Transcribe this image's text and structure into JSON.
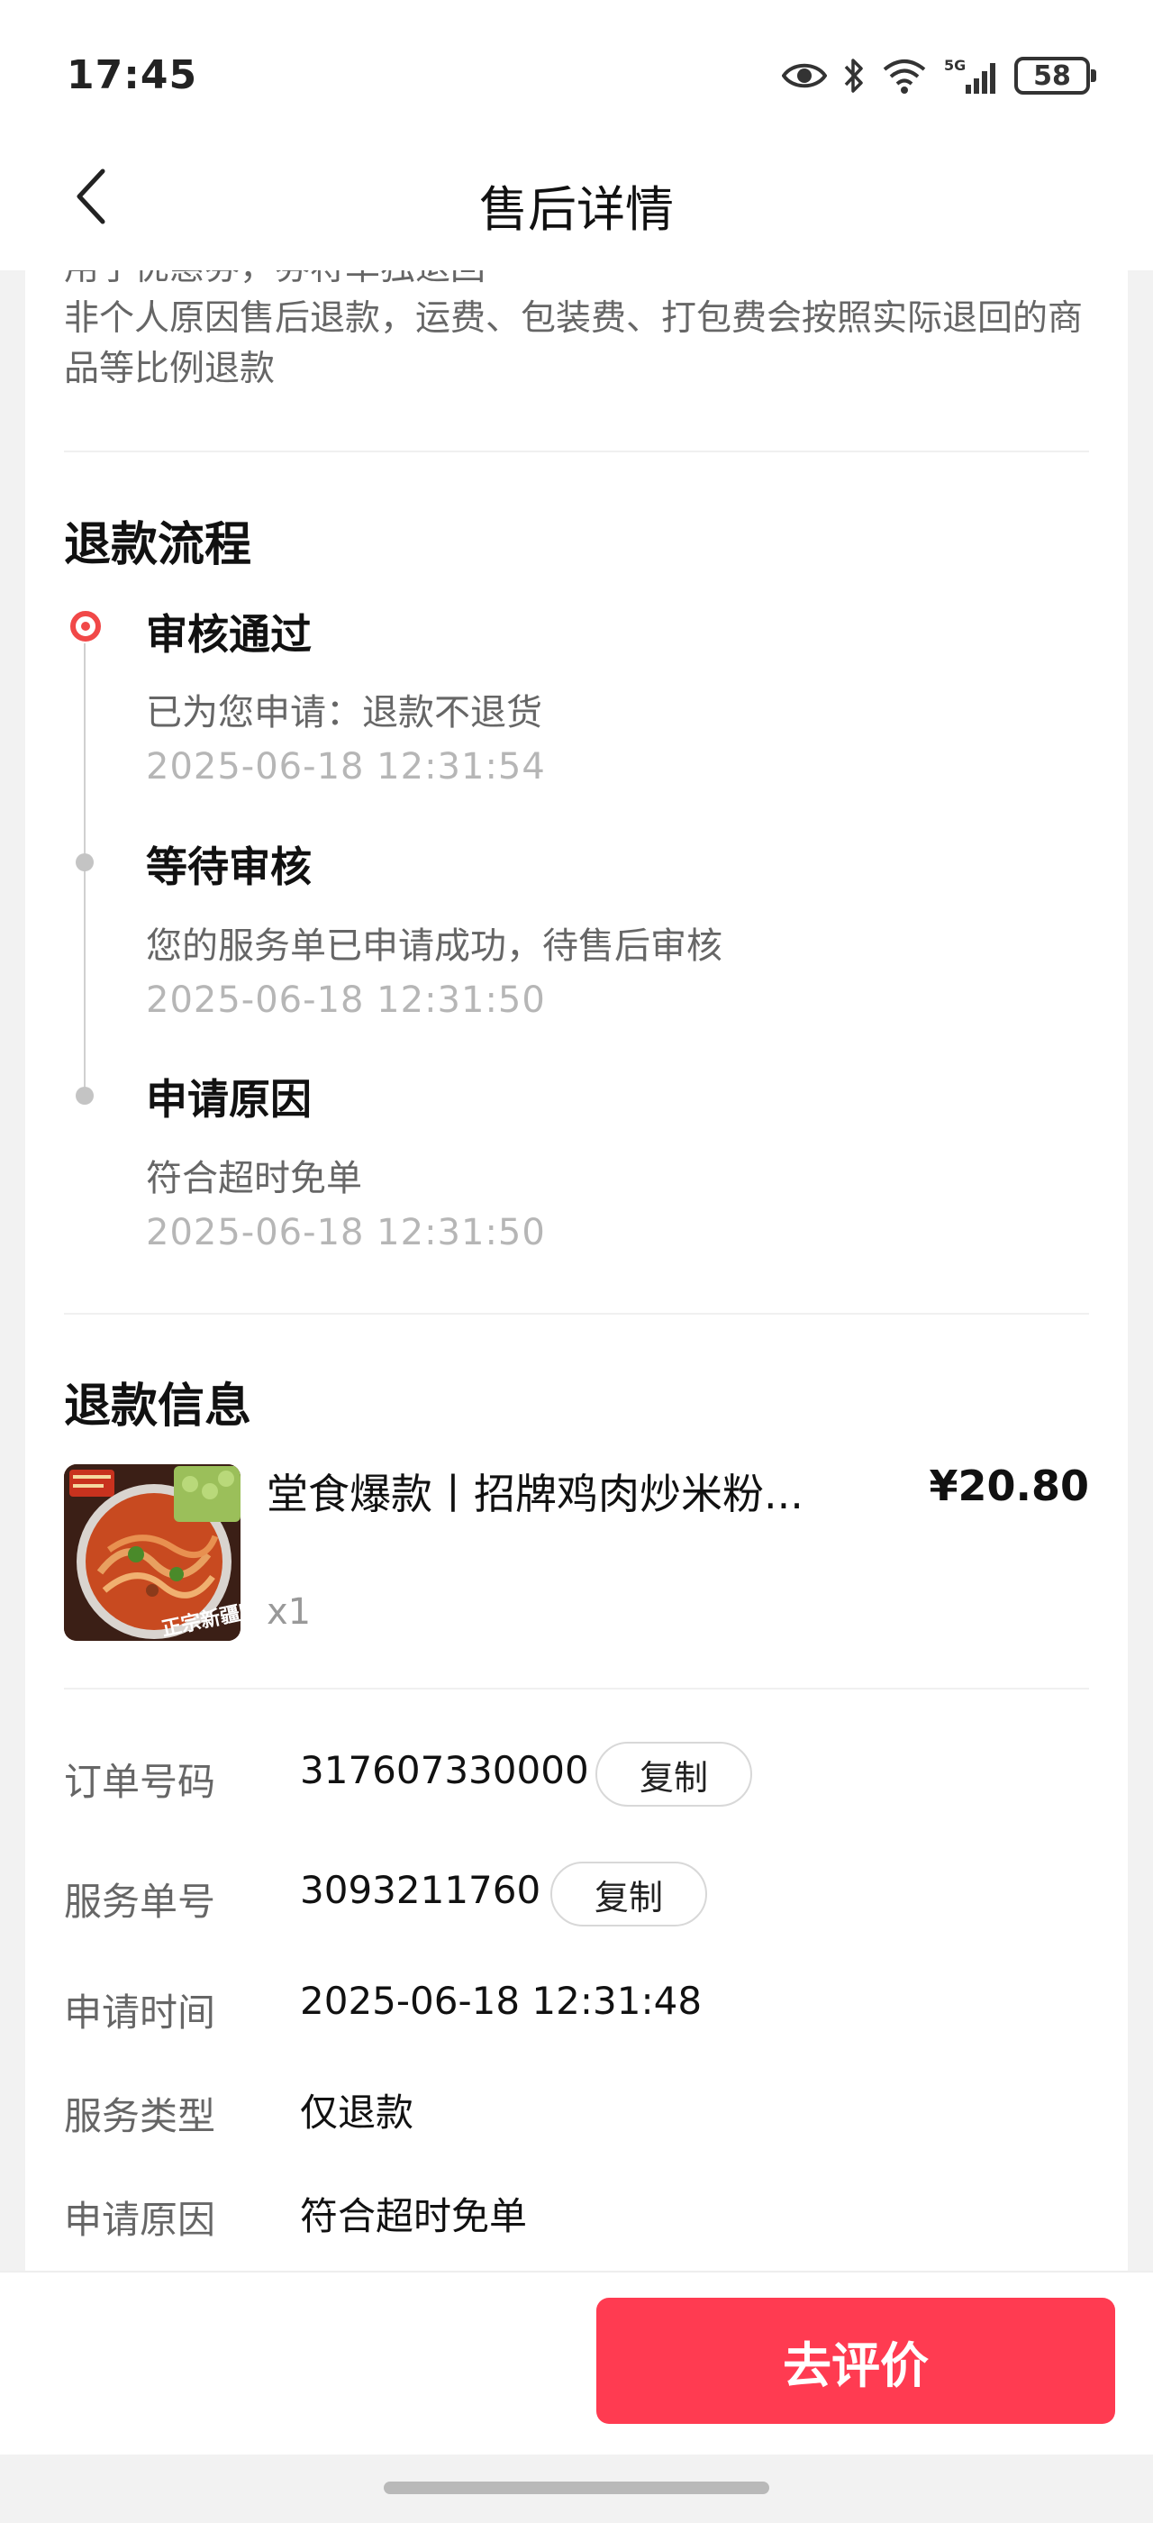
{
  "status_bar": {
    "time": "17:45",
    "battery": "58",
    "icons": [
      "eye-icon",
      "bluetooth-icon",
      "wifi-icon",
      "signal-5g-icon",
      "battery-icon"
    ]
  },
  "nav": {
    "back_icon": "chevron-left-icon",
    "title": "售后详情"
  },
  "notice": {
    "line1": "用了优惠券，券将单独退回",
    "line2": "非个人原因售后退款，运费、包装费、打包费会按照实际退回的商品等比例退款"
  },
  "refund_flow": {
    "title": "退款流程",
    "steps": [
      {
        "title": "审核通过",
        "desc": "已为您申请：退款不退货",
        "time": "2025-06-18 12:31:54"
      },
      {
        "title": "等待审核",
        "desc": "您的服务单已申请成功，待售后审核",
        "time": "2025-06-18 12:31:50"
      },
      {
        "title": "申请原因",
        "desc": "符合超时免单",
        "time": "2025-06-18 12:31:50"
      }
    ]
  },
  "refund_info": {
    "title": "退款信息",
    "product": {
      "name": "堂食爆款丨招牌鸡肉炒米粉...",
      "price": "¥20.80",
      "qty": "x1",
      "thumb_text": "正宗新疆味"
    },
    "rows": [
      {
        "label": "订单号码",
        "value": "317607330000",
        "action": "复制"
      },
      {
        "label": "服务单号",
        "value": "3093211760",
        "action": "复制"
      },
      {
        "label": "申请时间",
        "value": "2025-06-18 12:31:48"
      },
      {
        "label": "服务类型",
        "value": "仅退款"
      },
      {
        "label": "申请原因",
        "value": "符合超时免单"
      }
    ]
  },
  "bottom": {
    "review_button": "去评价"
  },
  "colors": {
    "accent": "#ff3b51",
    "timeline_active": "#f14848"
  }
}
